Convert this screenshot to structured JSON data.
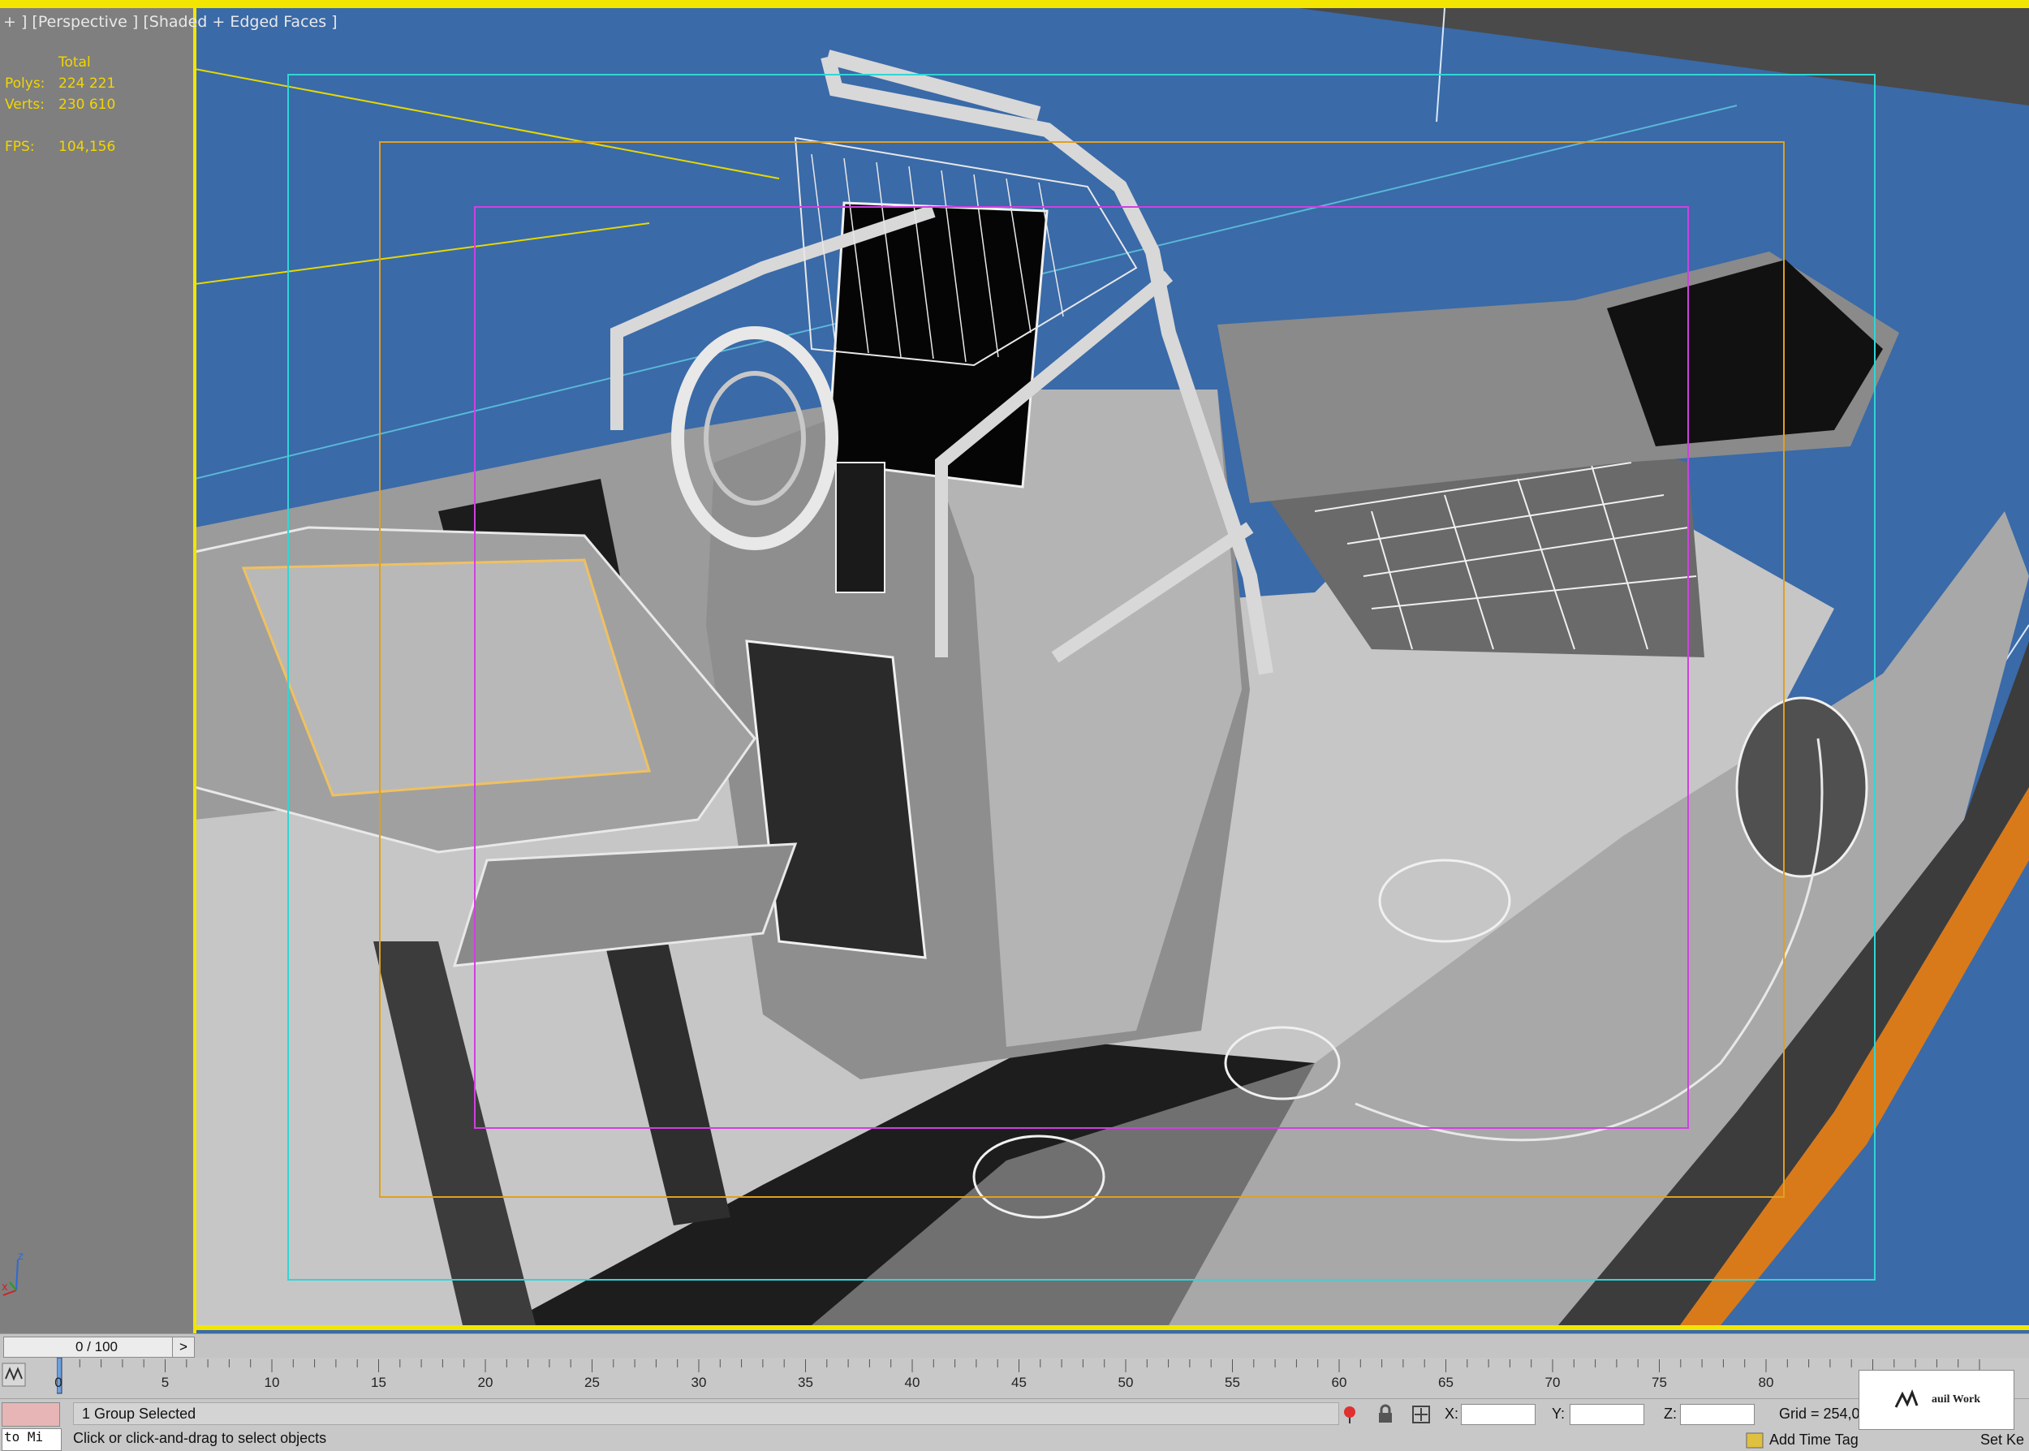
{
  "viewport": {
    "label": "+ ] [Perspective ] [Shaded + Edged Faces ]",
    "stats": {
      "total_label": "Total",
      "polys_label": "Polys:",
      "polys_value": "224 221",
      "verts_label": "Verts:",
      "verts_value": "230 610",
      "fps_label": "FPS:",
      "fps_value": "104,156"
    },
    "background_color": "#3a6aa8",
    "active_border_color": "#f2e600",
    "safe_frame_colors": [
      "#2fd6d6",
      "#e0a020",
      "#d040e0"
    ],
    "axis_labels": {
      "x": "x",
      "z": "z"
    }
  },
  "timeline": {
    "slider_label": "0 / 100",
    "next_button": ">",
    "ticks": [
      "0",
      "5",
      "10",
      "15",
      "20",
      "25",
      "30",
      "35",
      "40",
      "45",
      "50",
      "55",
      "60",
      "65",
      "70",
      "75",
      "80"
    ]
  },
  "status": {
    "selection": "1 Group Selected",
    "prompt": "Click or click-and-drag to select objects",
    "listener_text": "to Mi",
    "x_label": "X:",
    "y_label": "Y:",
    "z_label": "Z:",
    "grid": "Grid = 254,0",
    "add_time_tag": "Add Time Tag",
    "set_key": "Set Ke",
    "logo_text": "auil Work"
  }
}
